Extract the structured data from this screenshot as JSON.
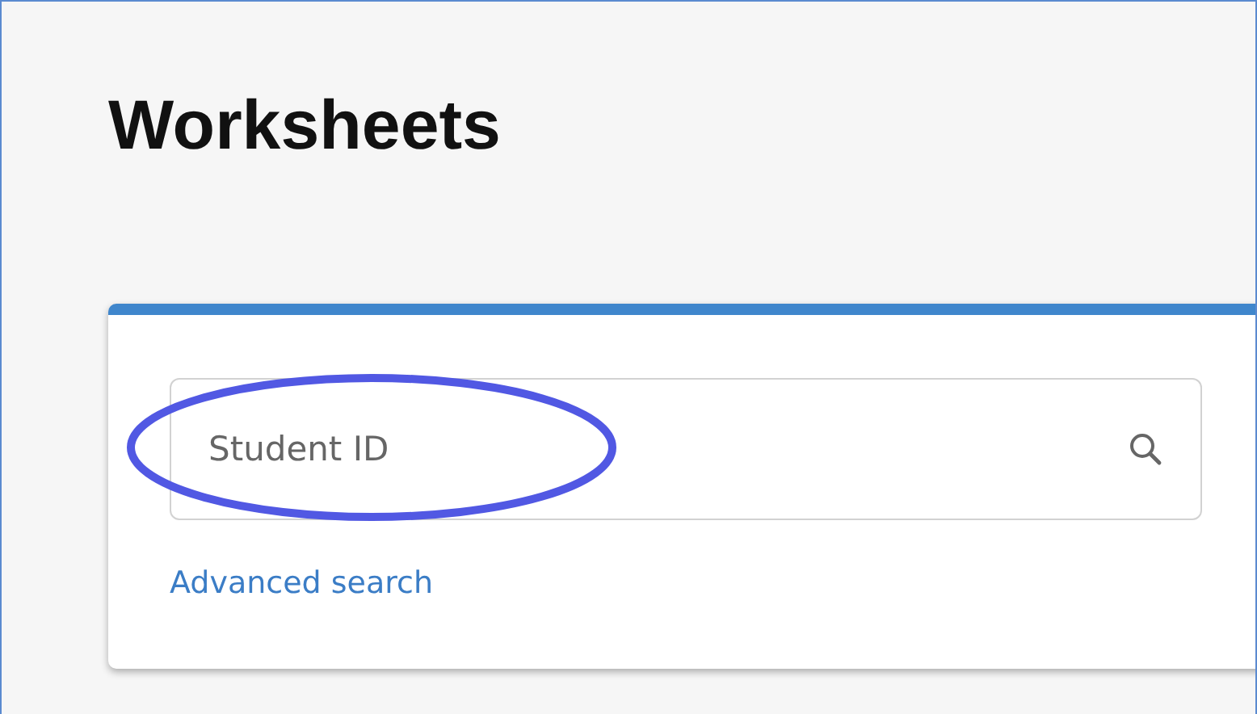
{
  "page": {
    "title": "Worksheets"
  },
  "search": {
    "placeholder": "Student ID"
  },
  "links": [
    {
      "label": "Advanced search"
    }
  ]
}
